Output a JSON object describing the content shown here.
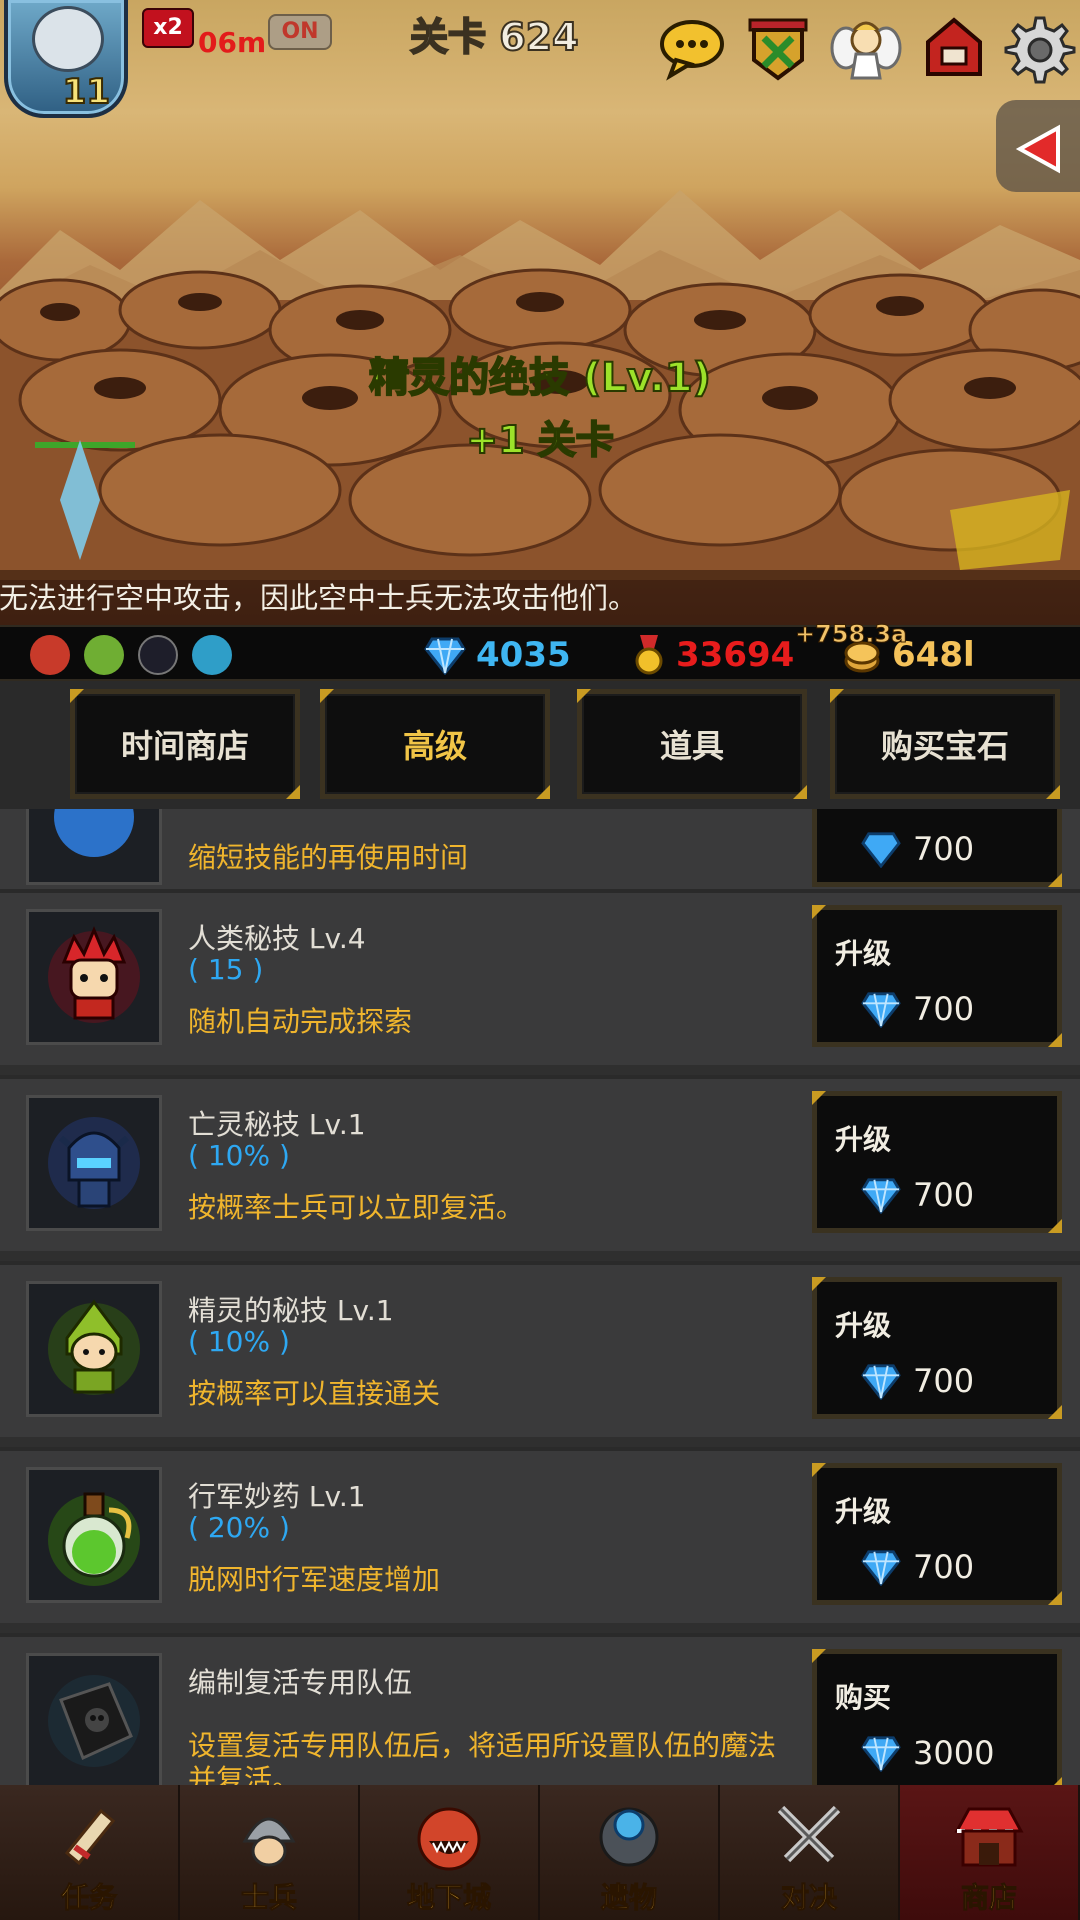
{
  "hud": {
    "player_level": "11",
    "speed_badge": "x2",
    "speed_timer": "06m",
    "auto_toggle": "ON",
    "stage_title": "关卡 624"
  },
  "scene": {
    "skill_name": "精灵的绝技 (Lv.1)",
    "skill_effect": "+1 关卡",
    "ticker": "击无法进行空中攻击，因此空中士兵无法攻击他们。"
  },
  "resources": {
    "gems": "4035",
    "medals": "33694",
    "gold": "648l",
    "gold_gain": "+758.3a",
    "colors": {
      "gems": "#3fb6f2",
      "medals": "#e81c1c",
      "gold": "#f4c25a"
    }
  },
  "tabs": [
    {
      "label": "时间商店",
      "active": false
    },
    {
      "label": "高级",
      "active": true
    },
    {
      "label": "道具",
      "active": false
    },
    {
      "label": "购买宝石",
      "active": false
    }
  ],
  "shop_items": [
    {
      "name": "",
      "value": "",
      "desc": "缩短技能的再使用时间",
      "button": "",
      "price": "700",
      "icon": "partial-skill-icon"
    },
    {
      "name": "人类秘技 Lv.4",
      "value": "( 15 )",
      "desc": "随机自动完成探索",
      "button": "升级",
      "price": "700",
      "icon": "human-hero-icon"
    },
    {
      "name": "亡灵秘技 Lv.1",
      "value": "( 10% )",
      "desc": "按概率士兵可以立即复活。",
      "button": "升级",
      "price": "700",
      "icon": "undead-knight-icon"
    },
    {
      "name": "精灵的秘技 Lv.1",
      "value": "( 10% )",
      "desc": "按概率可以直接通关",
      "button": "升级",
      "price": "700",
      "icon": "elf-hero-icon"
    },
    {
      "name": "行军妙药 Lv.1",
      "value": "( 20% )",
      "desc": "脱网时行军速度增加",
      "button": "升级",
      "price": "700",
      "icon": "potion-icon"
    },
    {
      "name": "编制复活专用队伍",
      "value": "",
      "desc": "设置复活专用队伍后，将适用所设置队伍的魔法并复活。",
      "button": "购买",
      "price": "3000",
      "icon": "skull-book-icon"
    }
  ],
  "nav": [
    {
      "label": "任务",
      "icon": "scroll-icon",
      "active": false
    },
    {
      "label": "士兵",
      "icon": "soldier-helmet-icon",
      "active": false
    },
    {
      "label": "地下城",
      "icon": "dungeon-monster-icon",
      "active": false
    },
    {
      "label": "遗物",
      "icon": "relic-orb-icon",
      "active": false
    },
    {
      "label": "对决",
      "icon": "crossed-swords-icon",
      "active": false
    },
    {
      "label": "商店",
      "icon": "shop-icon",
      "active": true
    }
  ]
}
